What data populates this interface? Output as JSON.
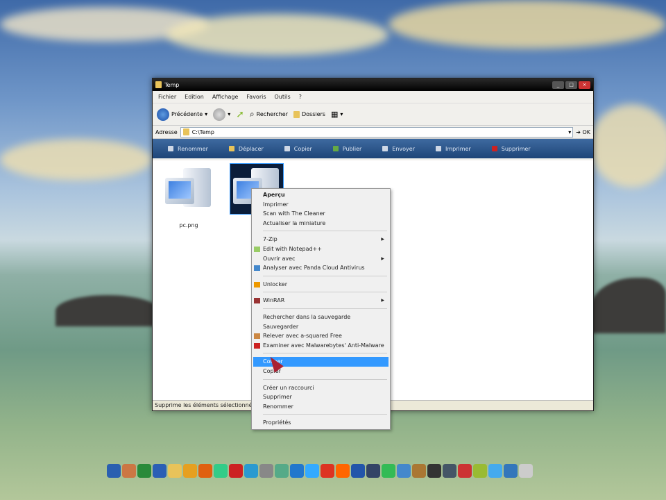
{
  "window": {
    "title": "Temp",
    "controls": [
      "_",
      "□",
      "×"
    ]
  },
  "menubar": [
    "Fichier",
    "Edition",
    "Affichage",
    "Favoris",
    "Outils",
    "?"
  ],
  "toolbar": {
    "back": "Précédente",
    "search": "Rechercher",
    "folders": "Dossiers"
  },
  "address": {
    "label": "Adresse",
    "value": "C:\\Temp",
    "go": "OK"
  },
  "tasks": [
    "Renommer",
    "Déplacer",
    "Copier",
    "Publier",
    "Envoyer",
    "Imprimer",
    "Supprimer"
  ],
  "files": [
    {
      "name": "pc.png",
      "selected": false
    },
    {
      "name": "",
      "selected": true
    }
  ],
  "status": "Supprime les éléments sélectionnés e",
  "context_menu": [
    {
      "label": "Aperçu",
      "bold": true
    },
    {
      "label": "Imprimer"
    },
    {
      "label": "Scan with The Cleaner"
    },
    {
      "label": "Actualiser la miniature"
    },
    {
      "sep": true
    },
    {
      "label": "7-Zip",
      "submenu": true
    },
    {
      "label": "Edit with Notepad++",
      "icon": "#9c6"
    },
    {
      "label": "Ouvrir avec",
      "submenu": true
    },
    {
      "label": "Analyser avec Panda Cloud Antivirus",
      "icon": "#48c"
    },
    {
      "sep": true
    },
    {
      "label": "Unlocker",
      "icon": "#e90"
    },
    {
      "sep": true
    },
    {
      "label": "WinRAR",
      "submenu": true,
      "icon": "#933"
    },
    {
      "sep": true
    },
    {
      "label": "Rechercher dans la sauvegarde"
    },
    {
      "label": "Sauvegarder"
    },
    {
      "label": "Relever avec a-squared Free",
      "icon": "#c84"
    },
    {
      "label": "Examiner avec Malwarebytes' Anti-Malware",
      "icon": "#c22"
    },
    {
      "sep": true
    },
    {
      "label": "Couper",
      "highlighted": true
    },
    {
      "label": "Copier"
    },
    {
      "sep": true
    },
    {
      "label": "Créer un raccourci"
    },
    {
      "label": "Supprimer"
    },
    {
      "label": "Renommer"
    },
    {
      "sep": true
    },
    {
      "label": "Propriétés"
    }
  ],
  "dock_colors": [
    "#2a5fb0",
    "#c74",
    "#2a8a3a",
    "#2b5fb5",
    "#e8c35a",
    "#e6a020",
    "#e06010",
    "#3c8",
    "#c22",
    "#2a9ad0",
    "#888",
    "#5a8",
    "#27c",
    "#3af",
    "#d32",
    "#f60",
    "#25a",
    "#346",
    "#3b5",
    "#48c",
    "#a73",
    "#333",
    "#456",
    "#c33",
    "#9b3",
    "#4ae",
    "#37b",
    "#ccc"
  ]
}
